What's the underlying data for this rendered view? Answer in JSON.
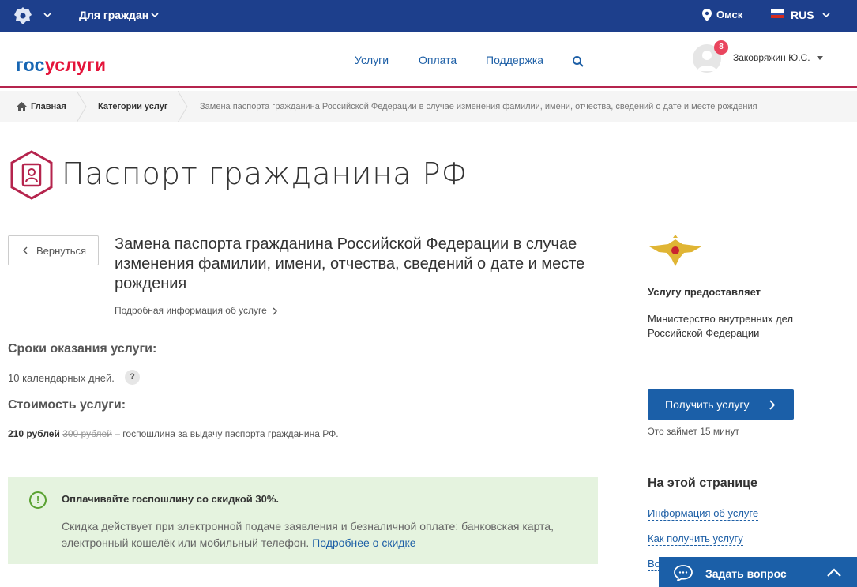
{
  "topbar": {
    "for_citizens": "Для граждан",
    "city": "Омск",
    "lang": "RUS",
    "flag_colors": [
      "#ffffff",
      "#2c52b0",
      "#d52b1e"
    ]
  },
  "header": {
    "logo_part1": "гос",
    "logo_part2": "услуги",
    "nav": [
      "Услуги",
      "Оплата",
      "Поддержка"
    ],
    "notifications": "8",
    "username": "Заковряжин Ю.С."
  },
  "breadcrumbs": {
    "home": "Главная",
    "categories": "Категории услуг",
    "current": "Замена паспорта гражданина Российской Федерации в случае изменения фамилии, имени, отчества, сведений о дате и месте рождения"
  },
  "page": {
    "title": "Паспорт гражданина РФ",
    "back": "Вернуться",
    "service_title": "Замена паспорта гражданина Российской Федерации в случае изменения фамилии, имени, отчества, сведений о дате и месте рождения",
    "more_info": "Подробная информация об услуге",
    "terms_heading": "Сроки оказания услуги:",
    "terms_value": "10 календарных дней.",
    "help": "?",
    "cost_heading": "Стоимость услуги:",
    "price": "210 рублей",
    "old_price": "300 рублей",
    "cost_note": " – госпошлина за выдачу паспорта гражданина РФ."
  },
  "promo": {
    "icon": "!",
    "title": "Оплачивайте госпошлину со скидкой 30%.",
    "text": "Скидка действует при электронной подаче заявления и безналичной оплате: банковская карта, электронный кошелёк или мобильный телефон. ",
    "link": "Подробнее о скидке"
  },
  "sidebar": {
    "provided_heading": "Услугу предоставляет",
    "provider": "Министерство внутренних дел Российской Федерации",
    "get_service": "Получить услугу",
    "takes": "Это займет 15 минут",
    "on_page": "На этой странице",
    "toc": [
      "Информация об услуге",
      "Как получить услугу",
      "Во"
    ]
  },
  "ask": {
    "label": "Задать вопрос"
  }
}
